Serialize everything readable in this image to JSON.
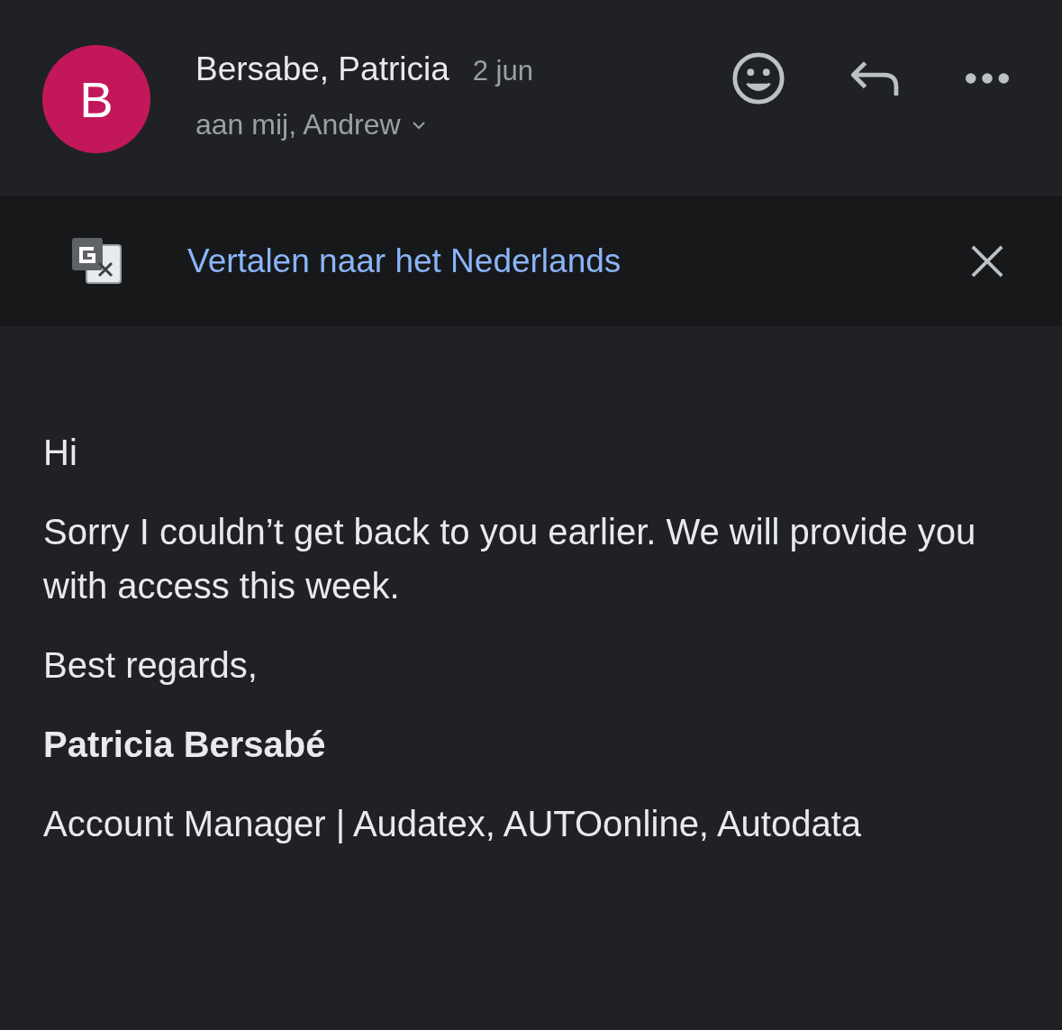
{
  "header": {
    "avatar_letter": "B",
    "sender": "Bersabe, Patricia",
    "date": "2 jun",
    "recipients": "aan mij, Andrew"
  },
  "translate_bar": {
    "link": "Vertalen naar het Nederlands"
  },
  "body": {
    "paragraphs": [
      {
        "kind": "text",
        "text": "Hi"
      },
      {
        "kind": "text",
        "text": "Sorry I couldn’t get back to you earlier. We will provide you with access this week."
      },
      {
        "kind": "text",
        "text": "Best regards,"
      },
      {
        "kind": "signature",
        "text": "Patricia Bersabé"
      },
      {
        "kind": "text",
        "text": "Account Manager | Audatex, AUTOonline, Autodata"
      }
    ]
  }
}
